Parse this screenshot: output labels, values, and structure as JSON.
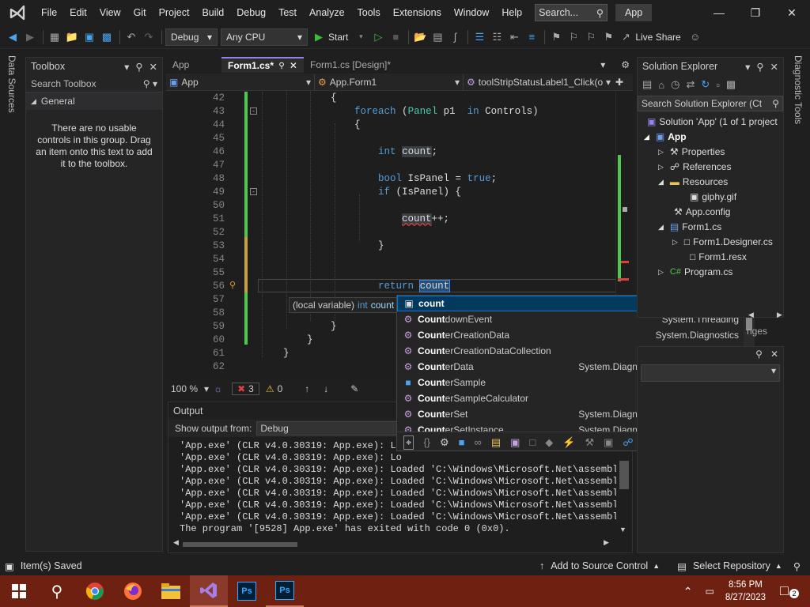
{
  "menubar": {
    "items": [
      "File",
      "Edit",
      "View",
      "Git",
      "Project",
      "Build",
      "Debug",
      "Test",
      "Analyze",
      "Tools",
      "Extensions",
      "Window",
      "Help"
    ],
    "search_label": "Search...",
    "app_badge": "App"
  },
  "toolbar": {
    "config": "Debug",
    "platform": "Any CPU",
    "start_label": "Start",
    "live_share": "Live Share"
  },
  "left_strip": {
    "label": "Data Sources"
  },
  "toolbox": {
    "title": "Toolbox",
    "search_placeholder": "Search Toolbox",
    "group": "General",
    "empty_message": "There are no usable controls in this group. Drag an item onto this text to add it to the toolbox."
  },
  "editor": {
    "tabs": [
      {
        "label": "App"
      },
      {
        "label": "Form1.cs*"
      },
      {
        "label": "Form1.cs [Design]*"
      }
    ],
    "nav": {
      "project": "App",
      "class": "App.Form1",
      "member": "toolStripStatusLabel1_Click(o"
    },
    "lines": [
      {
        "n": "42",
        "code": "            {"
      },
      {
        "n": "43",
        "code": "                foreach (Panel p1  in Controls)"
      },
      {
        "n": "44",
        "code": "                {"
      },
      {
        "n": "45",
        "code": ""
      },
      {
        "n": "46",
        "code": "                    int count;"
      },
      {
        "n": "47",
        "code": ""
      },
      {
        "n": "48",
        "code": "                    bool IsPanel = true;"
      },
      {
        "n": "49",
        "code": "                    if (IsPanel) {"
      },
      {
        "n": "50",
        "code": ""
      },
      {
        "n": "51",
        "code": "                        count++;"
      },
      {
        "n": "52",
        "code": ""
      },
      {
        "n": "53",
        "code": "                    }"
      },
      {
        "n": "54",
        "code": ""
      },
      {
        "n": "55",
        "code": ""
      },
      {
        "n": "56",
        "code": "                    return count"
      },
      {
        "n": "57",
        "code": ""
      },
      {
        "n": "58",
        "code": ""
      },
      {
        "n": "59",
        "code": "            }"
      },
      {
        "n": "60",
        "code": "        }"
      },
      {
        "n": "61",
        "code": "    }"
      },
      {
        "n": "62",
        "code": ""
      }
    ],
    "tooltip": {
      "prefix": "(local variable)",
      "type": "int",
      "name": "count"
    },
    "zoom": "100 %",
    "errors": "3",
    "warnings": "0"
  },
  "autocomplete": {
    "items": [
      {
        "match": "Count",
        "rest": "",
        "full": "count",
        "ns": ""
      },
      {
        "match": "Count",
        "rest": "downEvent",
        "ns": "System.Threading"
      },
      {
        "match": "Count",
        "rest": "erCreationData",
        "ns": "System.Diagnostics"
      },
      {
        "match": "Count",
        "rest": "erCreationDataCollection",
        "ns": "System.Diagnostics"
      },
      {
        "match": "Count",
        "rest": "erData",
        "ns": "System.Diagnostics.PerformanceData"
      },
      {
        "match": "Count",
        "rest": "erSample",
        "ns": "System.Diagnostics"
      },
      {
        "match": "Count",
        "rest": "erSampleCalculator",
        "ns": "System.Diagnostics"
      },
      {
        "match": "Count",
        "rest": "erSet",
        "ns": "System.Diagnostics.PerformanceData"
      },
      {
        "match": "Count",
        "rest": "erSetInstance",
        "ns": "System.Diagnostics.PerformanceData"
      }
    ]
  },
  "output": {
    "title": "Output",
    "show_from_label": "Show output from:",
    "source": "Debug",
    "lines": [
      "'App.exe' (CLR v4.0.30319: App.exe): Lo",
      "'App.exe' (CLR v4.0.30319: App.exe): Lo",
      "'App.exe' (CLR v4.0.30319: App.exe): Loaded 'C:\\Windows\\Microsoft.Net\\assembly\\",
      "'App.exe' (CLR v4.0.30319: App.exe): Loaded 'C:\\Windows\\Microsoft.Net\\assembly\\",
      "'App.exe' (CLR v4.0.30319: App.exe): Loaded 'C:\\Windows\\Microsoft.Net\\assembly\\",
      "'App.exe' (CLR v4.0.30319: App.exe): Loaded 'C:\\Windows\\Microsoft.Net\\assembly\\",
      "'App.exe' (CLR v4.0.30319: App.exe): Loaded 'C:\\Windows\\Microsoft.Net\\assembly\\",
      "The program '[9528] App.exe' has exited with code 0 (0x0)."
    ]
  },
  "solution_explorer": {
    "title": "Solution Explorer",
    "search_placeholder": "Search Solution Explorer (Ct",
    "solution": "Solution 'App' (1 of 1 project",
    "project": "App",
    "items": [
      "Properties",
      "References",
      "Resources",
      "giphy.gif",
      "App.config",
      "Form1.cs",
      "Form1.Designer.cs",
      "Form1.resx",
      "Program.cs"
    ],
    "partial_tab": "nges"
  },
  "right_strip": {
    "label": "Diagnostic Tools"
  },
  "statusbar": {
    "saved": "Item(s) Saved",
    "source_control": "Add to Source Control",
    "repo": "Select Repository"
  },
  "taskbar": {
    "time": "8:56 PM",
    "date": "8/27/2023",
    "notif_count": "2"
  }
}
